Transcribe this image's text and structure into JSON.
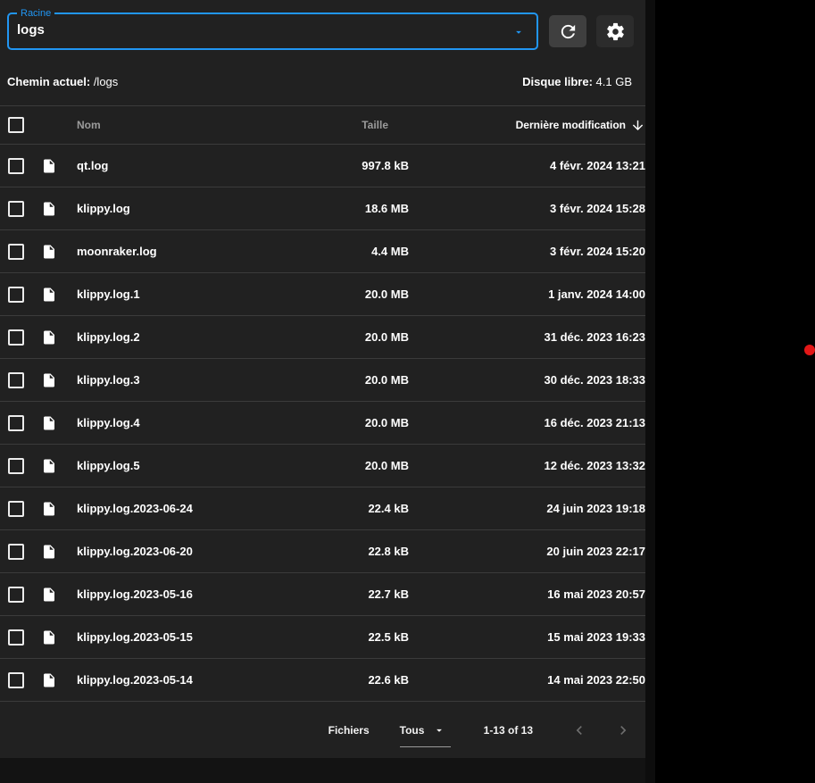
{
  "colors": {
    "accent": "#2196f3",
    "card_bg": "#212121",
    "page_bg_bottom": "#131313",
    "outside_bg": "#000000",
    "red_dot": "#e31717",
    "divider": "#3b3b3b",
    "header_text": "#9b9b9b"
  },
  "root_select": {
    "label": "Racine",
    "value": "logs"
  },
  "toolbar": {
    "refresh_icon": "refresh-circular-arrow",
    "settings_icon": "gear"
  },
  "info_bar": {
    "path_label": "Chemin actuel:",
    "path_value": "/logs",
    "disk_label": "Disque libre:",
    "disk_value": "4.1 GB"
  },
  "table": {
    "columns": {
      "name": "Nom",
      "size": "Taille",
      "modified": "Dernière modification"
    },
    "sort": {
      "column": "modified",
      "direction": "desc",
      "icon": "arrow-down"
    },
    "row_icon": "file-document",
    "rows": [
      {
        "name": "qt.log",
        "size": "997.8 kB",
        "modified": "4 févr. 2024 13:21"
      },
      {
        "name": "klippy.log",
        "size": "18.6 MB",
        "modified": "3 févr. 2024 15:28"
      },
      {
        "name": "moonraker.log",
        "size": "4.4 MB",
        "modified": "3 févr. 2024 15:20"
      },
      {
        "name": "klippy.log.1",
        "size": "20.0 MB",
        "modified": "1 janv. 2024 14:00"
      },
      {
        "name": "klippy.log.2",
        "size": "20.0 MB",
        "modified": "31 déc. 2023 16:23"
      },
      {
        "name": "klippy.log.3",
        "size": "20.0 MB",
        "modified": "30 déc. 2023 18:33"
      },
      {
        "name": "klippy.log.4",
        "size": "20.0 MB",
        "modified": "16 déc. 2023 21:13"
      },
      {
        "name": "klippy.log.5",
        "size": "20.0 MB",
        "modified": "12 déc. 2023 13:32"
      },
      {
        "name": "klippy.log.2023-06-24",
        "size": "22.4 kB",
        "modified": "24 juin 2023 19:18"
      },
      {
        "name": "klippy.log.2023-06-20",
        "size": "22.8 kB",
        "modified": "20 juin 2023 22:17"
      },
      {
        "name": "klippy.log.2023-05-16",
        "size": "22.7 kB",
        "modified": "16 mai 2023 20:57"
      },
      {
        "name": "klippy.log.2023-05-15",
        "size": "22.5 kB",
        "modified": "15 mai 2023 19:33"
      },
      {
        "name": "klippy.log.2023-05-14",
        "size": "22.6 kB",
        "modified": "14 mai 2023 22:50"
      }
    ]
  },
  "footer": {
    "items_label": "Fichiers",
    "per_page_value": "Tous",
    "range_text": "1-13 of 13",
    "prev_icon": "chevron-left",
    "next_icon": "chevron-right"
  }
}
